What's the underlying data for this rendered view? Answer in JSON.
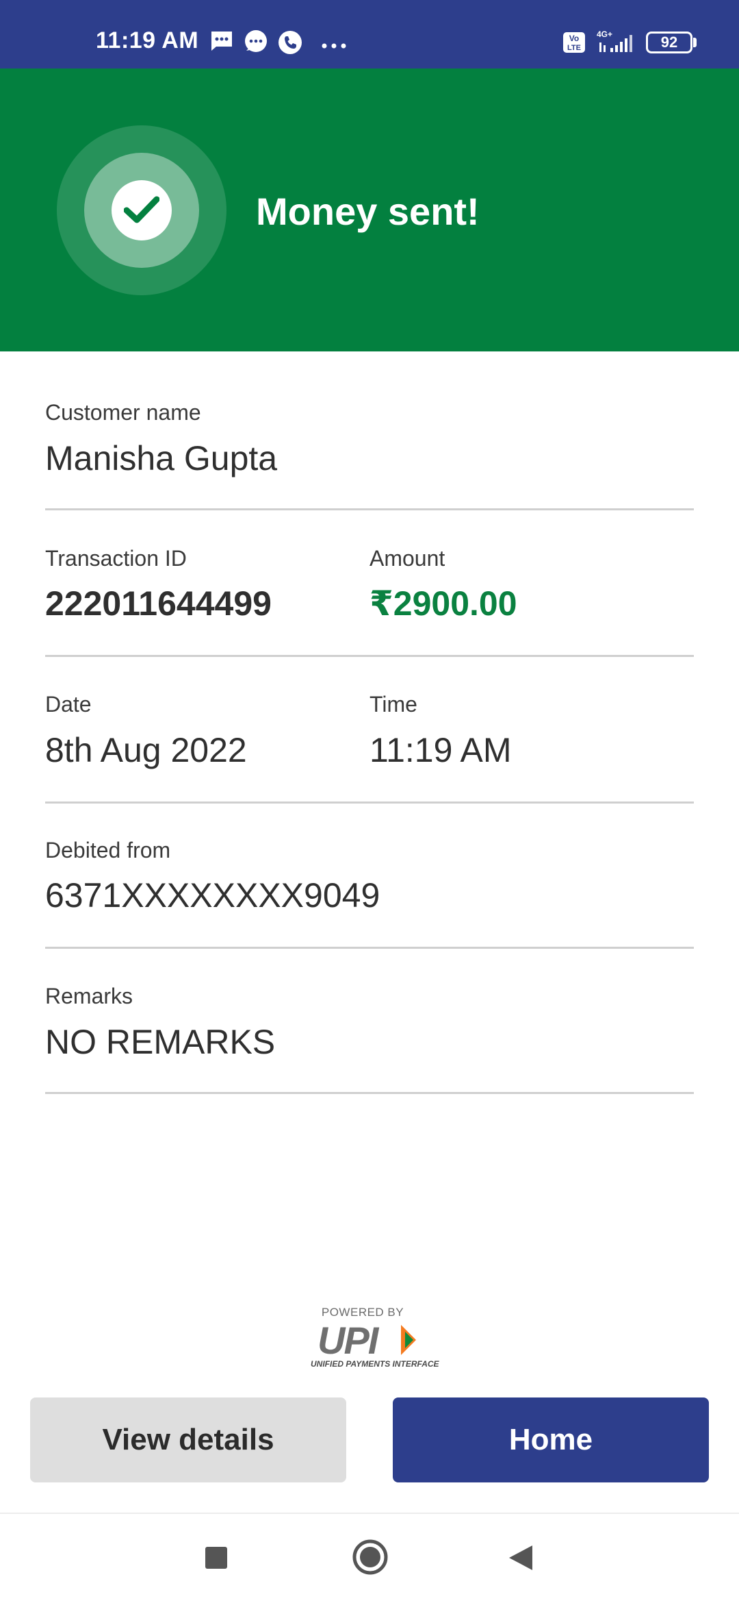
{
  "status_bar": {
    "time": "11:19 AM",
    "battery": "92",
    "network": "4G+",
    "volte": "Vo LTE",
    "icons": [
      "message-icon",
      "chat-bubble-icon",
      "phone-icon",
      "more-dots-icon",
      "volte-icon",
      "signal-icon",
      "battery-icon"
    ]
  },
  "banner": {
    "title": "Money sent!",
    "color": "#03803f",
    "icon": "check-icon"
  },
  "details": {
    "customer_name_label": "Customer name",
    "customer_name": "Manisha Gupta",
    "transaction_id_label": "Transaction ID",
    "transaction_id": "222011644499",
    "amount_label": "Amount",
    "amount": "₹2900.00",
    "date_label": "Date",
    "date": "8th Aug 2022",
    "time_label": "Time",
    "time": "11:19 AM",
    "debited_from_label": "Debited from",
    "debited_from": "6371XXXXXXXX9049",
    "remarks_label": "Remarks",
    "remarks": "NO REMARKS"
  },
  "upi": {
    "powered_by": "POWERED BY",
    "logo": "UPI",
    "subtitle": "UNIFIED PAYMENTS INTERFACE"
  },
  "actions": {
    "view_details": "View details",
    "home": "Home"
  },
  "colors": {
    "primary": "#2d3e8c",
    "success": "#03803f",
    "amount": "#0a8140"
  },
  "nav": {
    "icons": [
      "recents-square-icon",
      "home-circle-icon",
      "back-triangle-icon"
    ]
  }
}
